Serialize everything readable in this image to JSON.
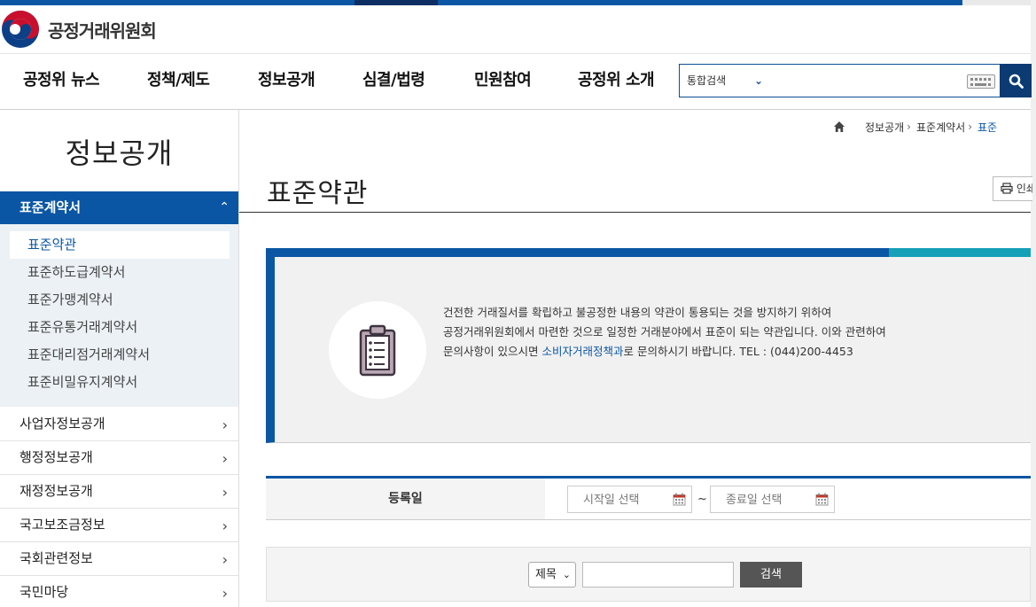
{
  "header": {
    "logo_text": "공정거래위원회",
    "nav": [
      "공정위 뉴스",
      "정책/제도",
      "정보공개",
      "심결/법령",
      "민원참여",
      "공정위 소개"
    ],
    "search": {
      "scope_label": "통합검색",
      "input_value": ""
    }
  },
  "sidebar": {
    "title": "정보공개",
    "active_section": "표준계약서",
    "sub_items": [
      "표준약관",
      "표준하도급계약서",
      "표준가맹계약서",
      "표준유통거래계약서",
      "표준대리점거래계약서",
      "표준비밀유지계약서"
    ],
    "active_sub_item": "표준약관",
    "sections": [
      "사업자정보공개",
      "행정정보공개",
      "재정정보공개",
      "국고보조금정보",
      "국회관련정보",
      "국민마당"
    ]
  },
  "breadcrumb": [
    "정보공개",
    "표준계약서",
    "표준"
  ],
  "page": {
    "title": "표준약관",
    "print_label": "인쇄"
  },
  "info": {
    "line1": "건전한 거래질서를 확립하고 불공정한 내용의 약관이 통용되는 것을 방지하기 위하여",
    "line2": "공정거래위원회에서 마련한 것으로 일정한 거래분야에서 표준이 되는 약관입니다. 이와 관련하여",
    "line3_pre": "문의사항이 있으시면 ",
    "line3_link": "소비자거래정책과",
    "line3_post": "로 문의하시기 바랍니다. TEL : (044)200-4453"
  },
  "filter": {
    "label": "등록일",
    "start_placeholder": "시작일 선택",
    "end_placeholder": "종료일 선택",
    "separator": "~"
  },
  "search_row": {
    "select_value": "제목",
    "input_value": "",
    "button_label": "검색"
  },
  "colors": {
    "primary": "#0b56a4",
    "dark_navy": "#0c3b73",
    "teal": "#16a0b8"
  }
}
